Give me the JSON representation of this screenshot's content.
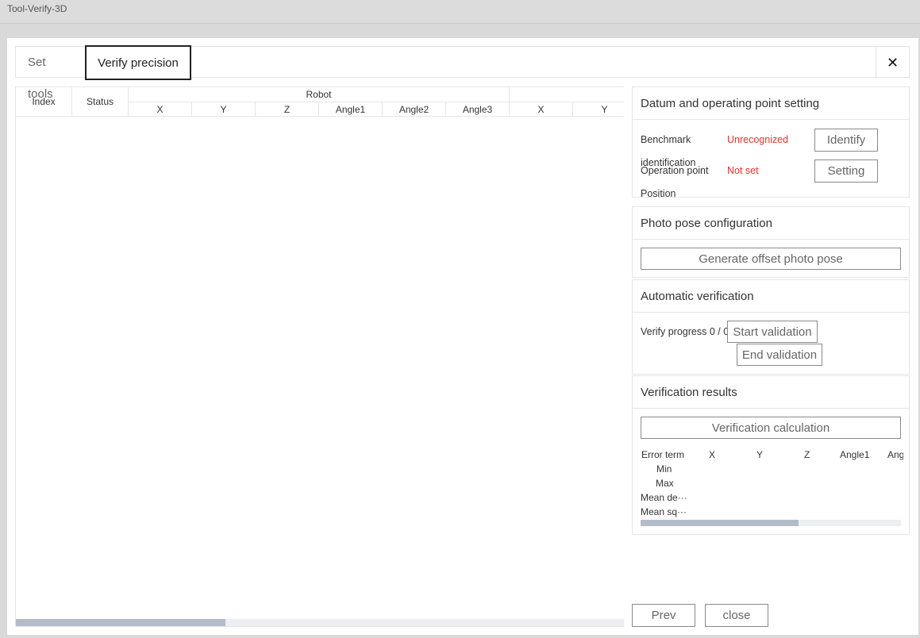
{
  "app": {
    "title": "Tool-Verify-3D"
  },
  "tabs": [
    {
      "label": "Set tools"
    },
    {
      "label": "Verify precision"
    }
  ],
  "close_glyph": "✕",
  "table": {
    "index_header": "Index",
    "status_header": "Status",
    "group_robot": "Robot",
    "columns": [
      "X",
      "Y",
      "Z",
      "Angle1",
      "Angle2",
      "Angle3",
      "X",
      "Y"
    ]
  },
  "datum": {
    "title": "Datum and operating point setting",
    "benchmark_label_1": "Benchmark",
    "benchmark_label_2": "identification",
    "benchmark_status": "Unrecognized",
    "identify_button": "Identify",
    "operation_label_1": "Operation point",
    "operation_label_2": "Position",
    "operation_status": "Not set",
    "setting_button": "Setting"
  },
  "photo": {
    "title": "Photo pose configuration",
    "generate_button": "Generate offset photo pose"
  },
  "auto": {
    "title": "Automatic verification",
    "progress_label": "Verify progress 0 / 0",
    "start_button": "Start validation",
    "end_button": "End validation"
  },
  "results": {
    "title": "Verification results",
    "calc_button": "Verification calculation",
    "headers": [
      "Error term",
      "X",
      "Y",
      "Z",
      "Angle1",
      "Ang"
    ],
    "rows": [
      "Min",
      "Max",
      "Mean de···",
      "Mean sq···"
    ]
  },
  "footer": {
    "prev_button": "Prev",
    "close_button": "close"
  },
  "colors": {
    "accent_red": "#e0352b",
    "scroll_thumb": "#b4bcc9"
  }
}
